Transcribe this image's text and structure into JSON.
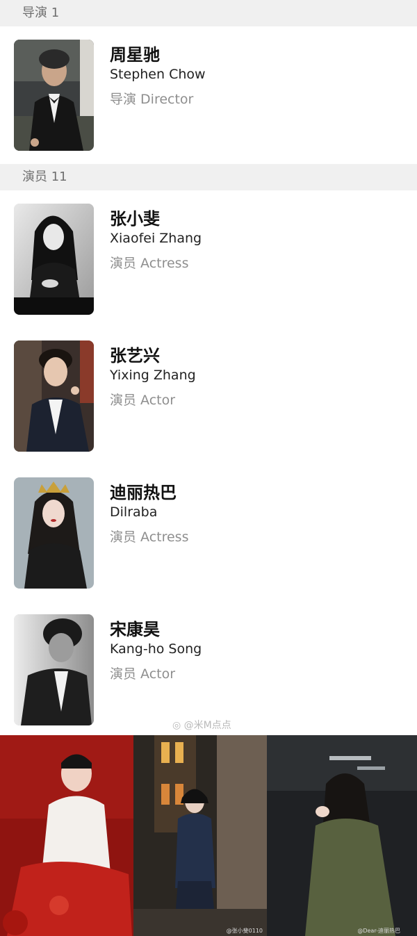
{
  "director_section": {
    "title": "导演 1"
  },
  "directors": [
    {
      "cn": "周星驰",
      "en": "Stephen Chow",
      "role": "导演 Director"
    }
  ],
  "actor_section": {
    "title": "演员 11"
  },
  "actors": [
    {
      "cn": "张小斐",
      "en": "Xiaofei Zhang",
      "role": "演员 Actress"
    },
    {
      "cn": "张艺兴",
      "en": "Yixing Zhang",
      "role": "演员 Actor"
    },
    {
      "cn": "迪丽热巴",
      "en": "Dilraba",
      "role": "演员 Actress"
    },
    {
      "cn": "宋康昊",
      "en": "Kang-ho Song",
      "role": "演员 Actor"
    }
  ],
  "watermark": "@米M点点",
  "credits": {
    "middle": "@张小斐0110",
    "right": "@Dear-迪丽热巴"
  },
  "colors": {
    "header_bg": "#f0f0f0",
    "header_text": "#6f6f6f",
    "role_text": "#8e8e8e"
  }
}
